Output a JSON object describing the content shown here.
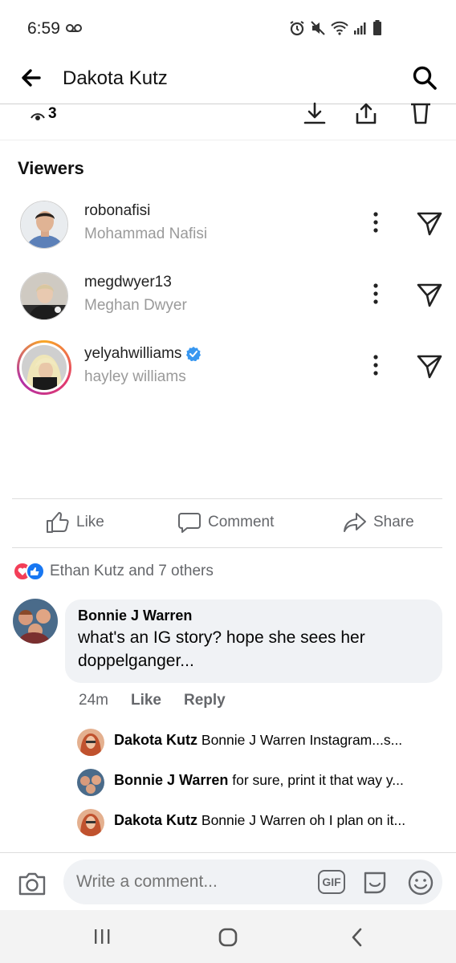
{
  "status_bar": {
    "time": "6:59",
    "icons": [
      "voicemail-icon",
      "alarm-icon",
      "mute-icon",
      "wifi-icon",
      "signal-icon",
      "battery-icon"
    ]
  },
  "header": {
    "title": "Dakota Kutz",
    "back_icon": "arrow-left-icon",
    "search_icon": "search-icon"
  },
  "story": {
    "view_count": "3",
    "actions": [
      "download-icon",
      "share-up-icon",
      "trash-icon"
    ]
  },
  "viewers": {
    "heading": "Viewers",
    "items": [
      {
        "username": "robonafisi",
        "fullname": "Mohammad Nafisi",
        "verified": false
      },
      {
        "username": "megdwyer13",
        "fullname": "Meghan Dwyer",
        "verified": false
      },
      {
        "username": "yelyahwilliams",
        "fullname": "hayley williams",
        "verified": true
      }
    ]
  },
  "post_actions": {
    "like": "Like",
    "comment": "Comment",
    "share": "Share"
  },
  "reactions": {
    "text": "Ethan Kutz and 7 others",
    "types": [
      "love",
      "like"
    ],
    "colors": {
      "love": "#f33e58",
      "like": "#1877f2"
    }
  },
  "comment": {
    "author": "Bonnie J Warren",
    "text": "what's an IG story? hope she sees her doppelganger...",
    "time": "24m",
    "like": "Like",
    "reply": "Reply"
  },
  "replies": [
    {
      "author": "Dakota Kutz",
      "text": "Bonnie J Warren Instagram...s..."
    },
    {
      "author": "Bonnie J Warren",
      "text": "for sure, print it that way y..."
    },
    {
      "author": "Dakota Kutz",
      "text": "Bonnie J Warren oh I plan on it..."
    }
  ],
  "composer": {
    "placeholder": "Write a comment...",
    "gif_label": "GIF"
  },
  "colors": {
    "verified": "#3897f0",
    "muted_text": "#65676b",
    "bubble": "#f0f2f5"
  }
}
